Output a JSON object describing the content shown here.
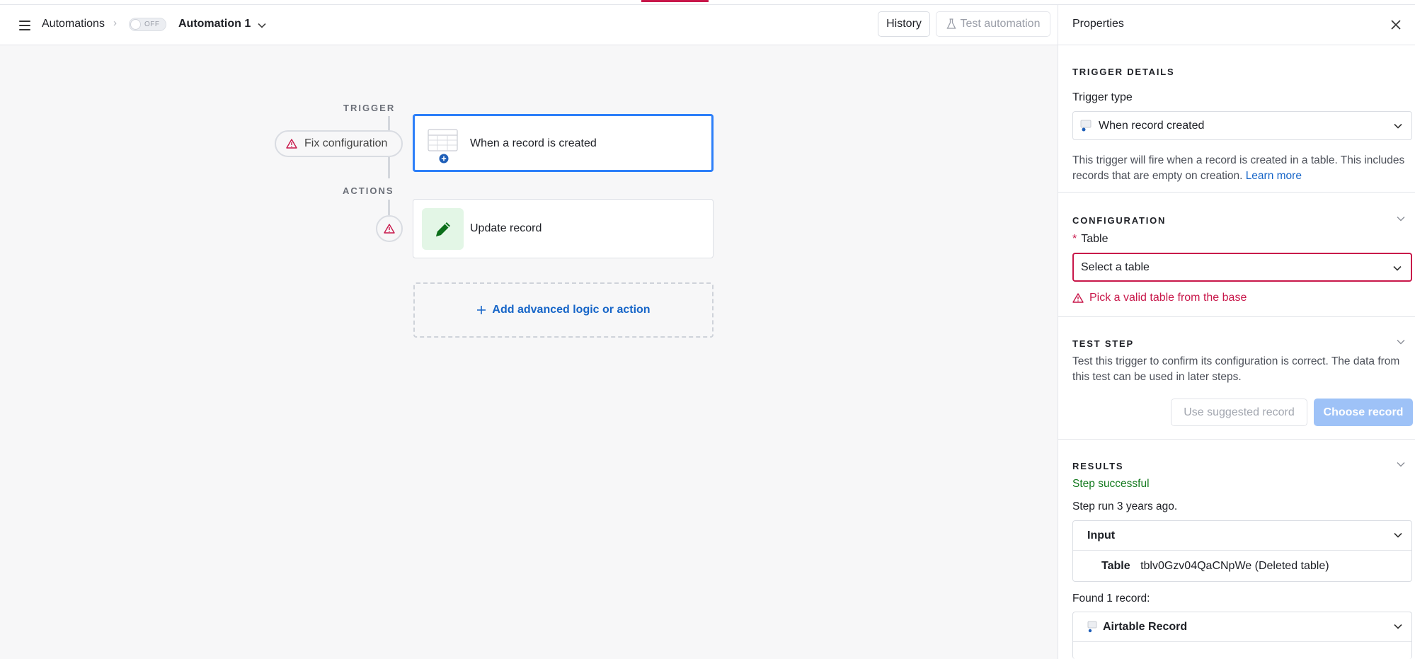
{
  "header": {
    "breadcrumb": "Automations",
    "toggle_state": "OFF",
    "automation_name": "Automation 1",
    "history_label": "History",
    "test_label": "Test automation"
  },
  "canvas": {
    "trigger_label": "TRIGGER",
    "actions_label": "ACTIONS",
    "fix_config_label": "Fix configuration",
    "trigger_card_title": "When a record is created",
    "action_card_title": "Update record",
    "add_logic_label": "Add advanced logic or action"
  },
  "panel": {
    "title": "Properties",
    "trigger_details": {
      "section_title": "TRIGGER DETAILS",
      "trigger_type_label": "Trigger type",
      "trigger_type_value": "When record created",
      "description": "This trigger will fire when a record is created in a table. This includes records that are empty on creation.",
      "learn_more": "Learn more"
    },
    "configuration": {
      "section_title": "CONFIGURATION",
      "required_mark": "*",
      "table_label": "Table",
      "table_placeholder": "Select a table",
      "error": "Pick a valid table from the base"
    },
    "test_step": {
      "section_title": "TEST STEP",
      "description": "Test this trigger to confirm its configuration is correct. The data from this test can be used in later steps.",
      "use_suggested_label": "Use suggested record",
      "choose_record_label": "Choose record"
    },
    "results": {
      "section_title": "RESULTS",
      "status": "Step successful",
      "run_info": "Step run 3 years ago.",
      "input_title": "Input",
      "input_key": "Table",
      "input_value": "tblv0Gzv04QaCNpWe (Deleted table)",
      "found_text": "Found 1 record:",
      "record_title": "Airtable Record"
    }
  },
  "colors": {
    "accent_blue": "#2d7ff9",
    "error_red": "#c8174a",
    "success_green": "#137a1e",
    "link_blue": "#1665c8"
  },
  "icons": [
    "menu-icon",
    "chevron-right-icon",
    "chevron-down-icon",
    "flask-icon",
    "warning-icon",
    "table-icon",
    "pencil-icon",
    "plus-icon",
    "close-icon"
  ]
}
